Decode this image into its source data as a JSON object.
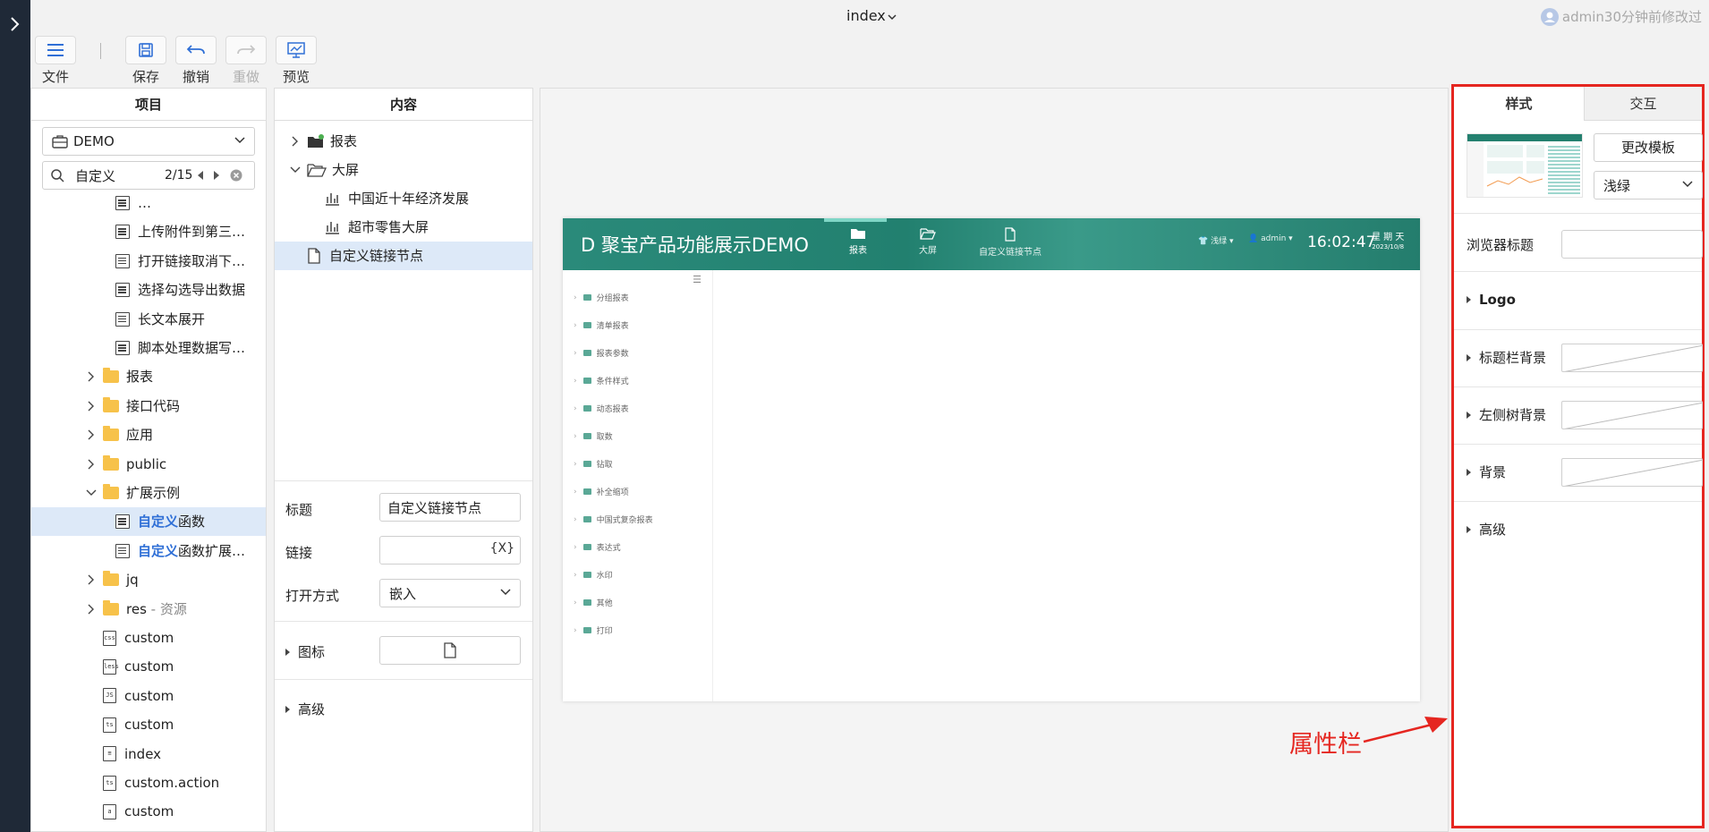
{
  "app": {
    "doc_title": "index",
    "user_status": "admin30分钟前修改过"
  },
  "toolbar": {
    "file": "文件",
    "save": "保存",
    "undo": "撤销",
    "redo": "重做",
    "preview": "预览"
  },
  "project": {
    "header": "项目",
    "workspace": "DEMO",
    "search_value": "自定义",
    "search_count": "2/15",
    "tree": [
      {
        "label": "…",
        "icon": "report-icon",
        "indent": 2
      },
      {
        "label": "上传附件到第三…",
        "icon": "report-icon",
        "indent": 2
      },
      {
        "label": "打开链接取消下…",
        "icon": "report-icon",
        "indent": 2
      },
      {
        "label": "选择勾选导出数据",
        "icon": "report-icon",
        "indent": 2
      },
      {
        "label": "长文本展开",
        "icon": "report-icon",
        "indent": 2
      },
      {
        "label": "脚本处理数据写…",
        "icon": "report-icon",
        "indent": 2
      },
      {
        "label": "报表",
        "icon": "folder-icon",
        "indent": 1,
        "arrow": "right"
      },
      {
        "label": "接口代码",
        "icon": "folder-icon",
        "indent": 1,
        "arrow": "right"
      },
      {
        "label": "应用",
        "icon": "folder-icon",
        "indent": 1,
        "arrow": "right"
      },
      {
        "label": "public",
        "icon": "folder-icon",
        "indent": 1,
        "arrow": "right"
      },
      {
        "label": "扩展示例",
        "icon": "folder-icon",
        "indent": 1,
        "arrow": "down"
      },
      {
        "label_hl": "自定义",
        "label_rest": "函数",
        "icon": "table-icon",
        "indent": 2,
        "selected": true
      },
      {
        "label_hl": "自定义",
        "label_rest": "函数扩展…",
        "icon": "doc-icon",
        "indent": 2
      },
      {
        "label": "jq",
        "icon": "folder-icon",
        "indent": 1,
        "arrow": "right"
      },
      {
        "label": "res",
        "label_muted": " - 资源",
        "icon": "folder-icon",
        "indent": 1,
        "arrow": "right"
      },
      {
        "label": "custom",
        "icon": "css-file-icon",
        "indent": 1,
        "file_tag": "css"
      },
      {
        "label": "custom",
        "icon": "less-file-icon",
        "indent": 1,
        "file_tag": "less"
      },
      {
        "label": "custom",
        "icon": "js-file-icon",
        "indent": 1,
        "file_tag": "JS"
      },
      {
        "label": "custom",
        "icon": "ts-file-icon",
        "indent": 1,
        "file_tag": "ts"
      },
      {
        "label": "index",
        "icon": "page-file-icon",
        "indent": 1,
        "file_tag": "≡"
      },
      {
        "label": "custom.action",
        "icon": "ts-file-icon",
        "indent": 1,
        "file_tag": "ts"
      },
      {
        "label": "custom",
        "icon": "text-file-icon",
        "indent": 1,
        "file_tag": "a"
      }
    ]
  },
  "content": {
    "header": "内容",
    "tree": [
      {
        "label": "报表",
        "arrow": "right"
      },
      {
        "label": "大屏",
        "arrow": "down"
      },
      {
        "label": "中国近十年经济发展"
      },
      {
        "label": "超市零售大屏"
      },
      {
        "label": "自定义链接节点",
        "selected": true
      }
    ],
    "form": {
      "title_label": "标题",
      "title_value": "自定义链接节点",
      "link_label": "链接",
      "link_value": "",
      "link_icon_text": "{X}",
      "open_mode_label": "打开方式",
      "open_mode_value": "嵌入",
      "icon_label": "图标",
      "advanced_label": "高级"
    }
  },
  "preview": {
    "title": "D  聚宝产品功能展示DEMO",
    "nav": [
      "报表",
      "大屏",
      "自定义链接节点"
    ],
    "theme_label": "浅绿",
    "user_label": "admin",
    "time": "16:02:47",
    "weekday": "星 期 天",
    "date": "2023/10/8",
    "side_items": [
      "分组报表",
      "清单报表",
      "报表参数",
      "条件样式",
      "动态报表",
      "取数",
      "钻取",
      "补全缩项",
      "中国式复杂报表",
      "表达式",
      "水印",
      "其他",
      "打印"
    ]
  },
  "props": {
    "tab_style": "样式",
    "tab_interact": "交互",
    "change_template": "更改模板",
    "theme": "浅绿",
    "browser_title_label": "浏览器标题",
    "browser_title_value": "",
    "logo": "Logo",
    "titlebar_bg": "标题栏背景",
    "lefttree_bg": "左侧树背景",
    "background": "背景",
    "advanced": "高级"
  },
  "annotation": {
    "text": "属性栏",
    "color": "#e52620"
  },
  "colors": {
    "accent": "#2f6fd6",
    "preview_header": "#22806f",
    "highlight_border": "#e52620",
    "selection": "#dde9f8"
  }
}
